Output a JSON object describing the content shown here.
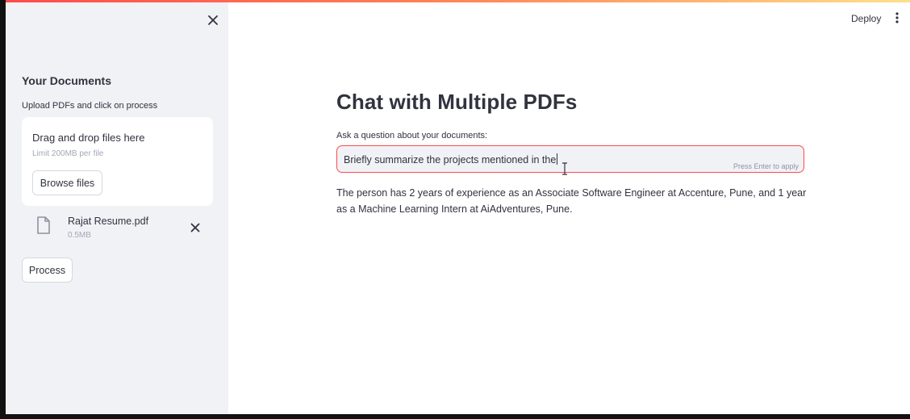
{
  "sidebar": {
    "title": "Your Documents",
    "caption": "Upload PDFs and click on process",
    "uploader": {
      "drop_text": "Drag and drop files here",
      "limit_text": "Limit 200MB per file",
      "browse_label": "Browse files"
    },
    "file": {
      "name": "Rajat Resume.pdf",
      "size": "0.5MB"
    },
    "process_label": "Process"
  },
  "header": {
    "deploy_label": "Deploy"
  },
  "main": {
    "title": "Chat with Multiple PDFs",
    "question_label": "Ask a question about your documents:",
    "question_value": "Briefly summarize the projects mentioned in the",
    "input_hint": "Press Enter to apply",
    "answer": "The person has 2 years of experience as an Associate Software Engineer at Accenture, Pune, and 1 year as a Machine Learning Intern at AiAdventures, Pune."
  },
  "colors": {
    "accent": "#ff4b4b",
    "sidebar_bg": "#f0f2f6",
    "text": "#31333f",
    "muted": "#a3a8b8"
  },
  "icons": [
    "close-icon",
    "file-icon",
    "remove-icon",
    "more-vert-icon",
    "text-cursor-icon"
  ]
}
